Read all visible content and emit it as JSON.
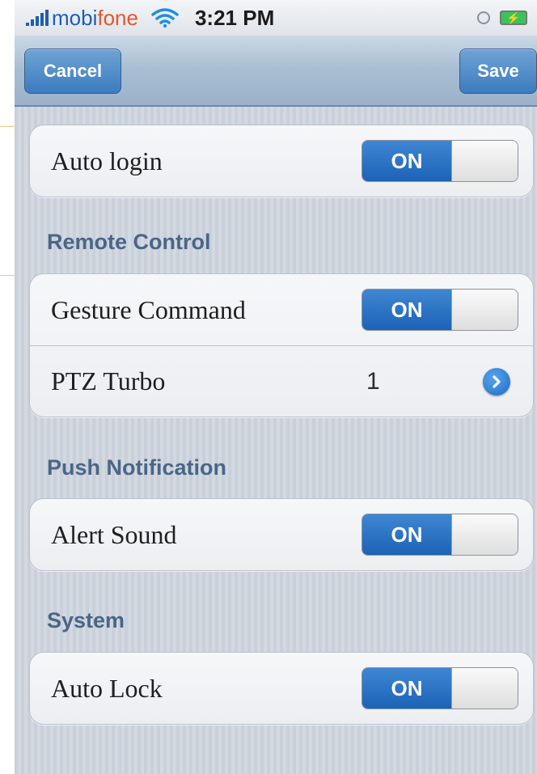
{
  "status_bar": {
    "carrier_prefix": "mobi",
    "carrier_suffix": "fone",
    "time": "3:21 PM",
    "icons": [
      "signal-bars-icon",
      "wifi-icon",
      "rotation-lock-icon",
      "battery-charging-icon"
    ]
  },
  "nav": {
    "cancel_label": "Cancel",
    "save_label": "Save"
  },
  "groups": {
    "general": {
      "auto_login": {
        "label": "Auto login",
        "toggle_label": "ON",
        "state": "on"
      }
    },
    "remote_control": {
      "header": "Remote Control",
      "gesture_command": {
        "label": "Gesture Command",
        "toggle_label": "ON",
        "state": "on"
      },
      "ptz_turbo": {
        "label": "PTZ Turbo",
        "value": "1"
      }
    },
    "push_notification": {
      "header": "Push Notification",
      "alert_sound": {
        "label": "Alert Sound",
        "toggle_label": "ON",
        "state": "on"
      }
    },
    "system": {
      "header": "System",
      "auto_lock": {
        "label": "Auto Lock",
        "toggle_label": "ON",
        "state": "on"
      }
    }
  },
  "colors": {
    "accent_blue": "#1c63b7",
    "section_header": "#4a6687",
    "carrier_blue": "#1e5fb0",
    "carrier_orange": "#e4572e"
  }
}
